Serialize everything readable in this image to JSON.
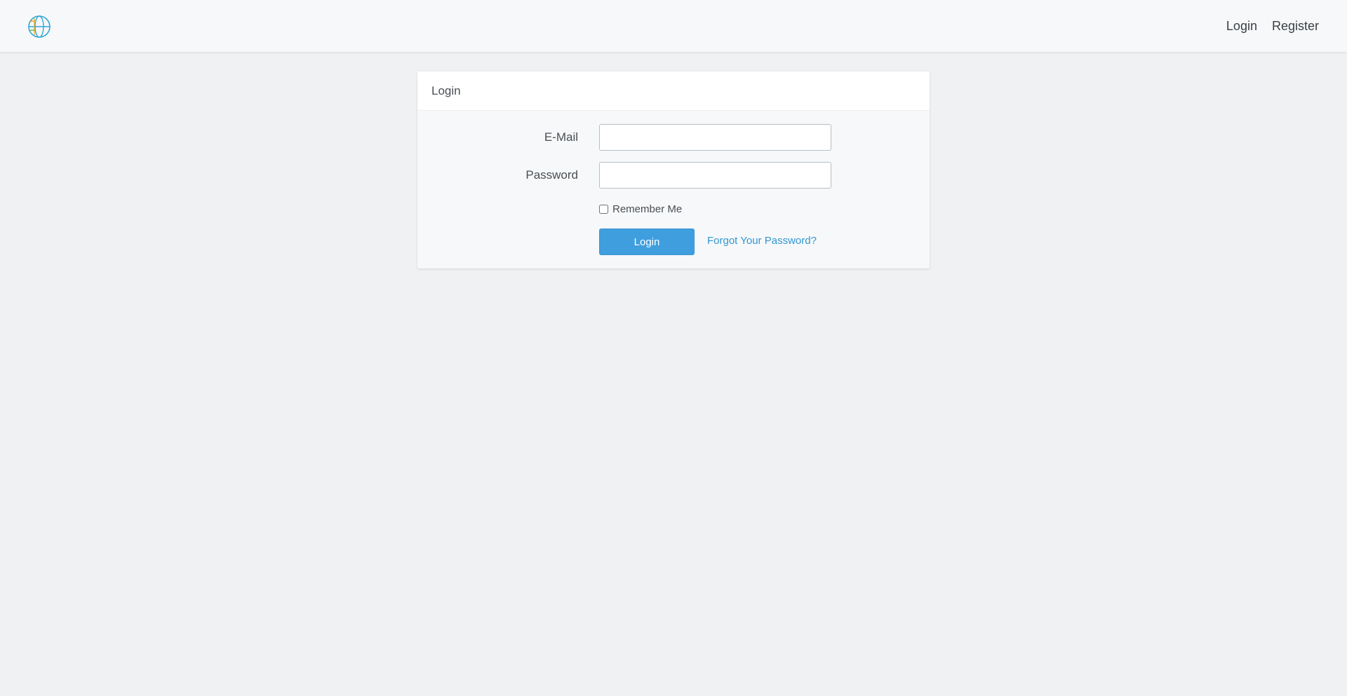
{
  "navbar": {
    "logo_icon": "globe-logo-icon",
    "links": [
      {
        "label": "Login"
      },
      {
        "label": "Register"
      }
    ]
  },
  "login_card": {
    "title": "Login",
    "email_label": "E-Mail",
    "email_value": "",
    "password_label": "Password",
    "password_value": "",
    "remember_label": "Remember Me",
    "remember_checked": false,
    "submit_label": "Login",
    "forgot_label": "Forgot Your Password?"
  },
  "colors": {
    "primary": "#3f9ede",
    "link": "#3397d0",
    "background": "#eff1f3"
  }
}
